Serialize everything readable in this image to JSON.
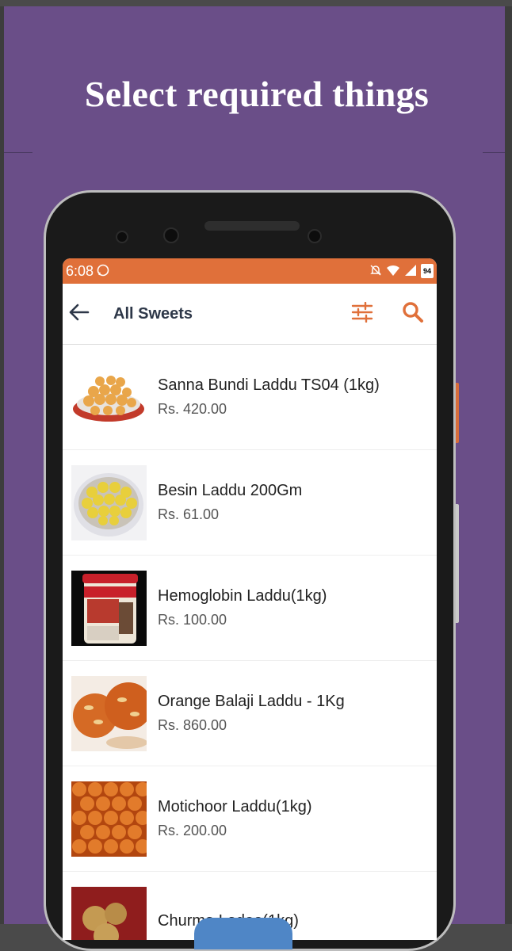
{
  "promo": {
    "headline": "Select required things"
  },
  "status_bar": {
    "time": "6:08",
    "battery": "94"
  },
  "app_bar": {
    "title": "All Sweets"
  },
  "products": [
    {
      "name": "Sanna Bundi Laddu TS04 (1kg)",
      "price": "Rs. 420.00"
    },
    {
      "name": "Besin Laddu 200Gm",
      "price": "Rs. 61.00"
    },
    {
      "name": "Hemoglobin Laddu(1kg)",
      "price": "Rs. 100.00"
    },
    {
      "name": "Orange Balaji Laddu - 1Kg",
      "price": "Rs. 860.00"
    },
    {
      "name": "Motichoor Laddu(1kg)",
      "price": "Rs. 200.00"
    },
    {
      "name": "Churma Ladoo(1kg)",
      "price": ""
    }
  ],
  "colors": {
    "accent": "#e0703a",
    "background": "#6a4e88"
  }
}
